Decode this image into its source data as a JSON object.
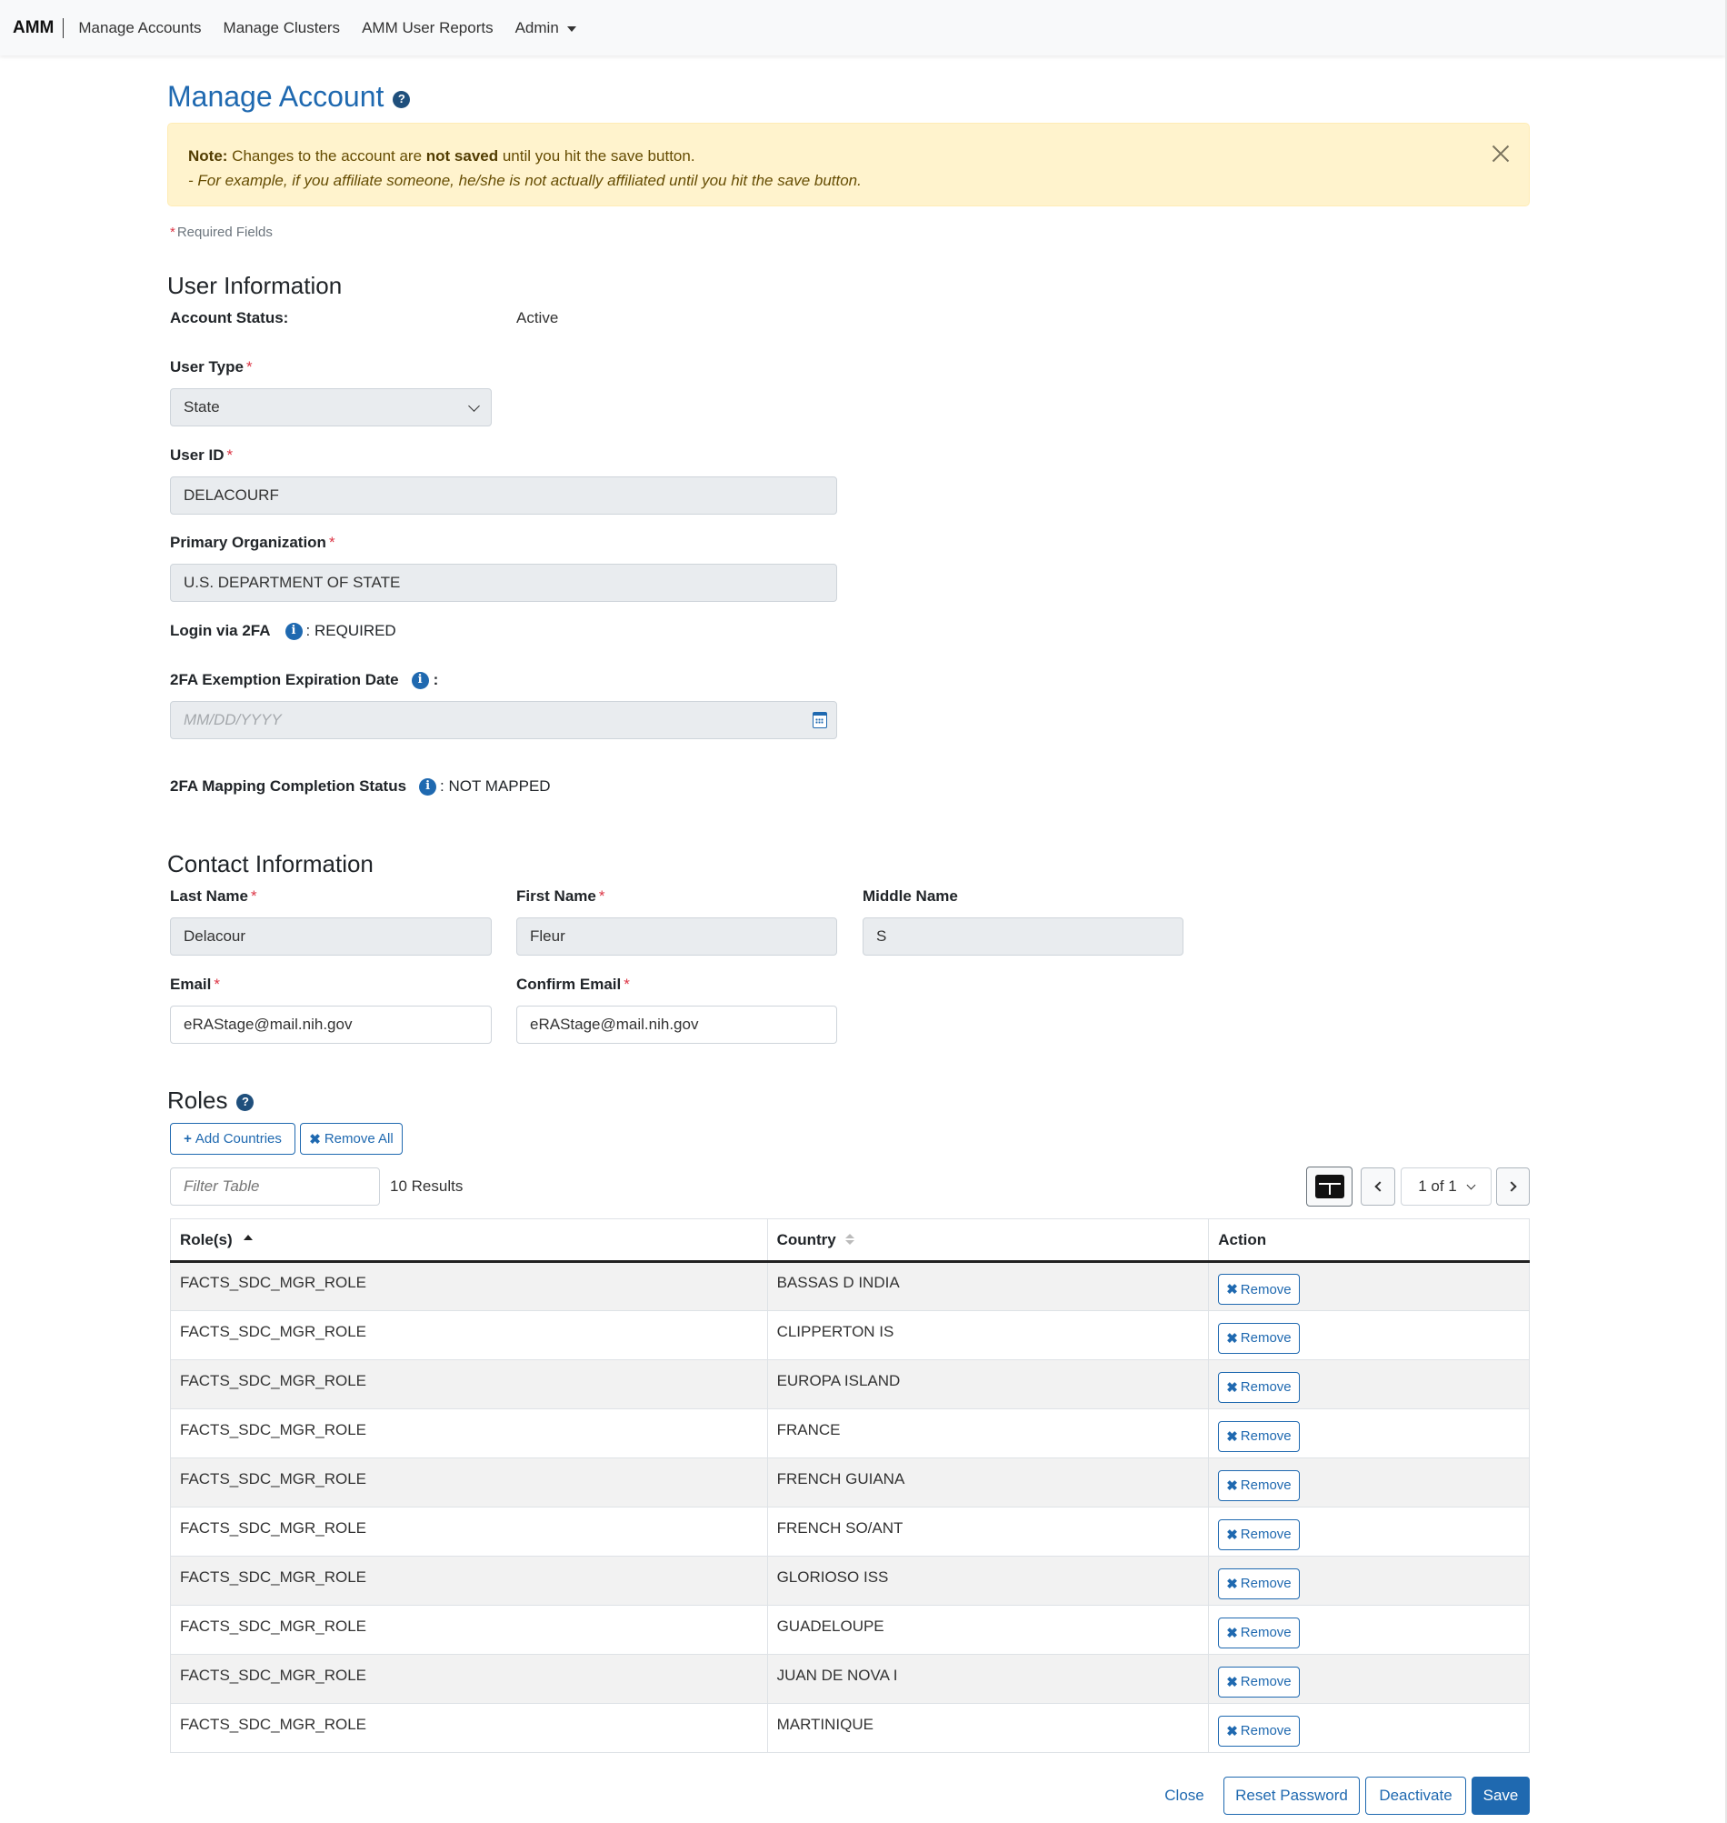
{
  "navbar": {
    "brand": "AMM",
    "links": [
      "Manage Accounts",
      "Manage Clusters",
      "AMM User Reports"
    ],
    "admin_label": "Admin"
  },
  "page": {
    "title": "Manage Account",
    "help_glyph": "?"
  },
  "alert": {
    "note_label": "Note:",
    "line1_part1": " Changes to the account are ",
    "line1_bold": "not saved",
    "line1_part2": " until you hit the save button.",
    "line2": "- For example, if you affiliate someone, he/she is not actually affiliated until you hit the save button."
  },
  "required_note": {
    "asterisk": "*",
    "text": "Required Fields"
  },
  "user_info": {
    "heading": "User Information",
    "account_status_label": "Account Status:",
    "account_status_value": "Active",
    "user_type_label": "User Type",
    "user_type_value": "State",
    "user_id_label": "User ID",
    "user_id_value": "DELACOURF",
    "primary_org_label": "Primary Organization",
    "primary_org_value": "U.S. DEPARTMENT OF STATE",
    "login_2fa_label": "Login via 2FA",
    "login_2fa_value": ": REQUIRED",
    "exemption_label": "2FA Exemption Expiration Date",
    "exemption_colon": ":",
    "exemption_placeholder": "MM/DD/YYYY",
    "mapping_label": "2FA Mapping Completion Status",
    "mapping_value": ": NOT MAPPED",
    "info_glyph": "i",
    "asterisk": "*"
  },
  "contact_info": {
    "heading": "Contact Information",
    "last_name_label": "Last Name",
    "last_name_value": "Delacour",
    "first_name_label": "First Name",
    "first_name_value": "Fleur",
    "middle_name_label": "Middle Name",
    "middle_name_value": "S",
    "email_label": "Email",
    "email_value": "eRAStage@mail.nih.gov",
    "confirm_email_label": "Confirm Email",
    "confirm_email_value": "eRAStage@mail.nih.gov"
  },
  "roles": {
    "heading": "Roles",
    "add_countries_label": "Add Countries",
    "add_glyph": "+",
    "remove_all_label": "Remove All",
    "remove_glyph": "✖",
    "filter_placeholder": "Filter Table",
    "results_text": "10 Results",
    "page_indicator": "1 of 1",
    "columns": [
      "Role(s)",
      "Country",
      "Action"
    ],
    "remove_label": "Remove",
    "rows": [
      {
        "role": "FACTS_SDC_MGR_ROLE",
        "country": "BASSAS D INDIA"
      },
      {
        "role": "FACTS_SDC_MGR_ROLE",
        "country": "CLIPPERTON IS"
      },
      {
        "role": "FACTS_SDC_MGR_ROLE",
        "country": "EUROPA ISLAND"
      },
      {
        "role": "FACTS_SDC_MGR_ROLE",
        "country": "FRANCE"
      },
      {
        "role": "FACTS_SDC_MGR_ROLE",
        "country": "FRENCH GUIANA"
      },
      {
        "role": "FACTS_SDC_MGR_ROLE",
        "country": "FRENCH SO/ANT"
      },
      {
        "role": "FACTS_SDC_MGR_ROLE",
        "country": "GLORIOSO ISS"
      },
      {
        "role": "FACTS_SDC_MGR_ROLE",
        "country": "GUADELOUPE"
      },
      {
        "role": "FACTS_SDC_MGR_ROLE",
        "country": "JUAN DE NOVA I"
      },
      {
        "role": "FACTS_SDC_MGR_ROLE",
        "country": "MARTINIQUE"
      }
    ]
  },
  "footer": {
    "close_label": "Close",
    "reset_password_label": "Reset Password",
    "deactivate_label": "Deactivate",
    "save_label": "Save"
  },
  "colors": {
    "primary": "#1f69b0",
    "alert_bg": "#fff3cd",
    "required": "#dc3545"
  }
}
